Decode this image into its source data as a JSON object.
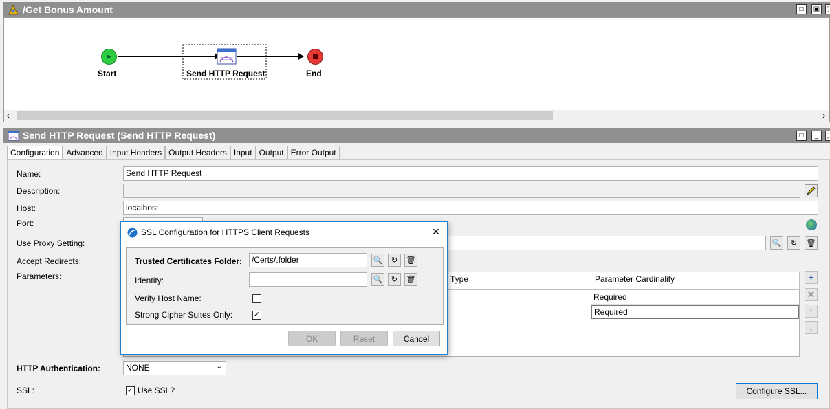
{
  "workflow": {
    "title": "/Get Bonus Amount",
    "nodes": {
      "start": "Start",
      "task": "Send HTTP Request",
      "end": "End"
    }
  },
  "properties": {
    "title": "Send HTTP Request (Send HTTP Request)",
    "tabs": [
      "Configuration",
      "Advanced",
      "Input Headers",
      "Output Headers",
      "Input",
      "Output",
      "Error Output"
    ],
    "labels": {
      "name": "Name:",
      "description": "Description:",
      "host": "Host:",
      "port": "Port:",
      "proxy": "Use Proxy Setting:",
      "redirects": "Accept Redirects:",
      "parameters": "Parameters:",
      "auth": "HTTP Authentication:",
      "ssl": "SSL:"
    },
    "values": {
      "name": "Send HTTP Request",
      "description": "",
      "host": "localhost",
      "auth": "NONE",
      "use_ssl": "Use SSL?"
    },
    "param_table": {
      "columns": [
        "Type",
        "Parameter Cardinality"
      ],
      "rows": [
        [
          "",
          "Required"
        ],
        [
          "",
          "Required"
        ]
      ]
    },
    "configure_ssl": "Configure SSL..."
  },
  "dialog": {
    "title": "SSL Configuration for HTTPS Client Requests",
    "labels": {
      "trusted": "Trusted Certificates Folder:",
      "identity": "Identity:",
      "verify": "Verify Host Name:",
      "strong": "Strong Cipher Suites Only:"
    },
    "values": {
      "trusted": "/Certs/.folder",
      "identity": "",
      "verify": false,
      "strong": true
    },
    "buttons": {
      "ok": "OK",
      "reset": "Reset",
      "cancel": "Cancel"
    },
    "close": "✕"
  },
  "colors": {
    "title_bar": "#8f8f8f",
    "start_node": "#2ecc40",
    "end_node": "#e53935",
    "dialog_border": "#1f7fcf"
  },
  "icons": {
    "workflow": "workflow-icon",
    "http": "http-request-icon",
    "browse": "binoculars-icon",
    "refresh": "refresh-icon",
    "delete": "trash-icon",
    "edit": "pencil-icon",
    "globe": "globe-icon",
    "add": "plus-icon",
    "remove": "x-icon",
    "up": "arrow-up-icon",
    "down": "arrow-down-icon"
  }
}
